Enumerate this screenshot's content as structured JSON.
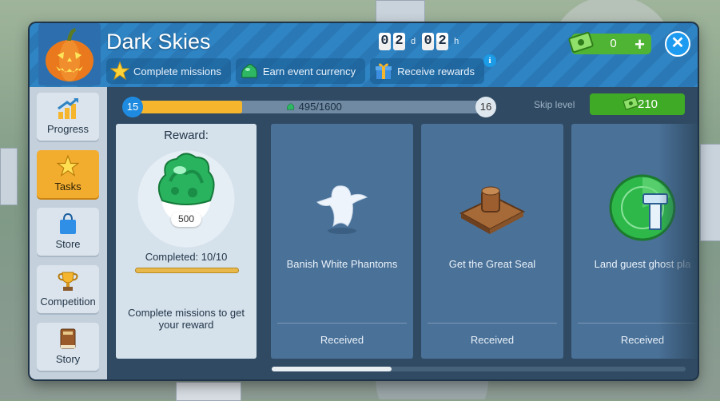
{
  "header": {
    "title": "Dark Skies",
    "timer": {
      "d1": "0",
      "d2": "2",
      "unit1": "d",
      "h1": "0",
      "h2": "2",
      "unit2": "h"
    },
    "tabs": [
      {
        "label": "Complete missions",
        "icon": "star-icon"
      },
      {
        "label": "Earn event currency",
        "icon": "slime-gem-icon"
      },
      {
        "label": "Receive rewards",
        "icon": "gift-icon"
      }
    ],
    "info_label": "i",
    "currency": {
      "value": "0",
      "plus": "+"
    },
    "close_label": "✕"
  },
  "sidebar": {
    "items": [
      {
        "label": "Progress",
        "icon": "progress-chart-icon",
        "active": false
      },
      {
        "label": "Tasks",
        "icon": "star-icon",
        "active": true
      },
      {
        "label": "Store",
        "icon": "shopping-bag-icon",
        "active": false
      },
      {
        "label": "Competition",
        "icon": "trophy-icon",
        "active": false
      },
      {
        "label": "Story",
        "icon": "book-icon",
        "active": false
      }
    ]
  },
  "progress": {
    "current_level": "15",
    "next_level": "16",
    "text": "495/1600",
    "fraction": 0.31,
    "skip_label": "Skip level",
    "skip_cost": "210"
  },
  "reward": {
    "title": "Reward:",
    "amount": "500",
    "completed": "Completed: 10/10",
    "completed_fraction": 1.0,
    "description": "Complete missions to get your reward"
  },
  "missions": [
    {
      "name": "Banish White Phantoms",
      "status": "Received",
      "icon": "ghost-icon"
    },
    {
      "name": "Get the Great Seal",
      "status": "Received",
      "icon": "seal-stamp-icon"
    },
    {
      "name": "Land guest ghost pla",
      "status": "Received",
      "icon": "radar-tower-icon"
    }
  ],
  "scroll": {
    "position_fraction": 0.0
  },
  "colors": {
    "accent": "#f3ad2e",
    "brand_blue": "#2f84c4",
    "green": "#3faa25"
  }
}
